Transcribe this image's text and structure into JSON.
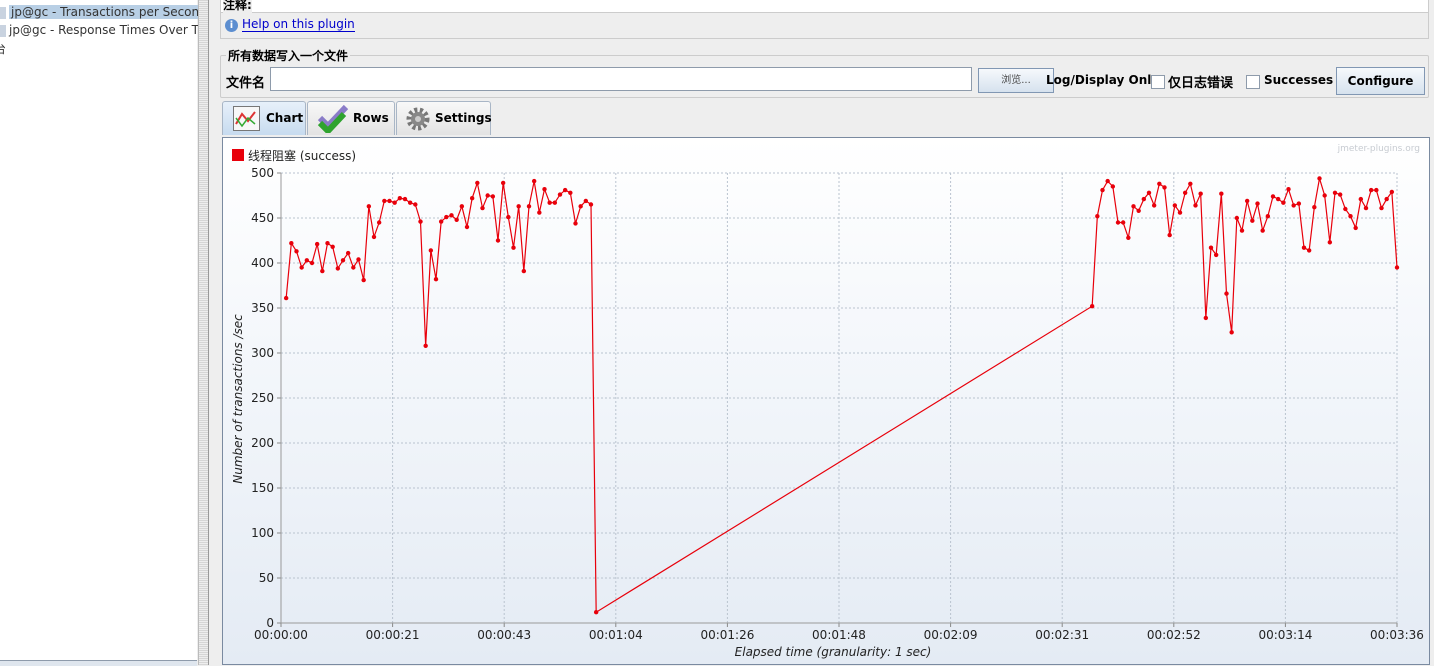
{
  "tree": {
    "items": [
      {
        "label": "jp@gc - Transactions per Second",
        "selected": true
      },
      {
        "label": "jp@gc - Response Times Over Tim",
        "selected": false
      },
      {
        "label": "台",
        "selected": false
      }
    ]
  },
  "comment_label": "注释:",
  "help_link": "Help on this plugin",
  "file_section": {
    "title": "所有数据写入一个文件",
    "filename_label": "文件名",
    "filename_value": "",
    "browse_button": "浏览...",
    "log_display_label": "Log/Display Only:",
    "errors_only_label": "仅日志错误",
    "errors_only_checked": false,
    "successes_label": "Successes",
    "successes_checked": false,
    "configure_button": "Configure"
  },
  "tabs": [
    {
      "label": "Chart",
      "icon": "chart-icon",
      "active": true
    },
    {
      "label": "Rows",
      "icon": "checkmark-icon",
      "active": false
    },
    {
      "label": "Settings",
      "icon": "gear-icon",
      "active": false
    }
  ],
  "watermark": "jmeter-plugins.org",
  "colors": {
    "series": "#e8000b",
    "selection": "#b8cfe5"
  },
  "chart_data": {
    "type": "line",
    "xlabel": "Elapsed time (granularity: 1 sec)",
    "ylabel": "Number of transactions /sec",
    "xlim": [
      0,
      216
    ],
    "ylim": [
      0,
      500
    ],
    "x_ticks": [
      "00:00:00",
      "00:00:21",
      "00:00:43",
      "00:01:04",
      "00:01:26",
      "00:01:48",
      "00:02:09",
      "00:02:31",
      "00:02:52",
      "00:03:14",
      "00:03:36"
    ],
    "y_ticks": [
      0,
      50,
      100,
      150,
      200,
      250,
      300,
      350,
      400,
      450,
      500
    ],
    "grid": true,
    "legend": "top-left",
    "series": [
      {
        "name": "线程阻塞 (success)",
        "color": "#e8000b",
        "x_seconds": [
          1,
          2,
          3,
          4,
          5,
          6,
          7,
          8,
          9,
          10,
          11,
          12,
          13,
          14,
          15,
          16,
          17,
          18,
          19,
          20,
          21,
          22,
          23,
          24,
          25,
          26,
          27,
          28,
          29,
          30,
          31,
          32,
          33,
          34,
          35,
          36,
          37,
          38,
          39,
          40,
          41,
          42,
          43,
          44,
          45,
          46,
          47,
          48,
          49,
          50,
          51,
          52,
          53,
          54,
          55,
          56,
          57,
          58,
          59,
          60,
          61,
          157,
          158,
          159,
          160,
          161,
          162,
          163,
          164,
          165,
          166,
          167,
          168,
          169,
          170,
          171,
          172,
          173,
          174,
          175,
          176,
          177,
          178,
          179,
          180,
          181,
          182,
          183,
          184,
          185,
          186,
          187,
          188,
          189,
          190,
          191,
          192,
          193,
          194,
          195,
          196,
          197,
          198,
          199,
          200,
          201,
          202,
          203,
          204,
          205,
          206,
          207,
          208,
          209,
          210,
          211,
          212,
          213,
          214,
          215,
          216
        ],
        "values": [
          361,
          422,
          413,
          395,
          403,
          400,
          421,
          391,
          422,
          418,
          394,
          403,
          411,
          395,
          404,
          381,
          463,
          429,
          445,
          469,
          469,
          467,
          472,
          471,
          467,
          465,
          446,
          308,
          414,
          382,
          446,
          451,
          453,
          448,
          463,
          440,
          472,
          489,
          461,
          475,
          474,
          425,
          489,
          451,
          417,
          463,
          391,
          463,
          491,
          456,
          482,
          467,
          467,
          476,
          481,
          478,
          444,
          463,
          469,
          465,
          12,
          352,
          452,
          481,
          491,
          485,
          445,
          445,
          428,
          463,
          458,
          471,
          478,
          464,
          488,
          484,
          431,
          464,
          456,
          478,
          488,
          464,
          477,
          339,
          417,
          409,
          477,
          366,
          323,
          450,
          436,
          469,
          447,
          466,
          436,
          452,
          474,
          471,
          467,
          482,
          464,
          466,
          417,
          414,
          462,
          494,
          475,
          423,
          478,
          476,
          460,
          452,
          439,
          471,
          461,
          481,
          481,
          461,
          471,
          479,
          395
        ]
      }
    ]
  }
}
